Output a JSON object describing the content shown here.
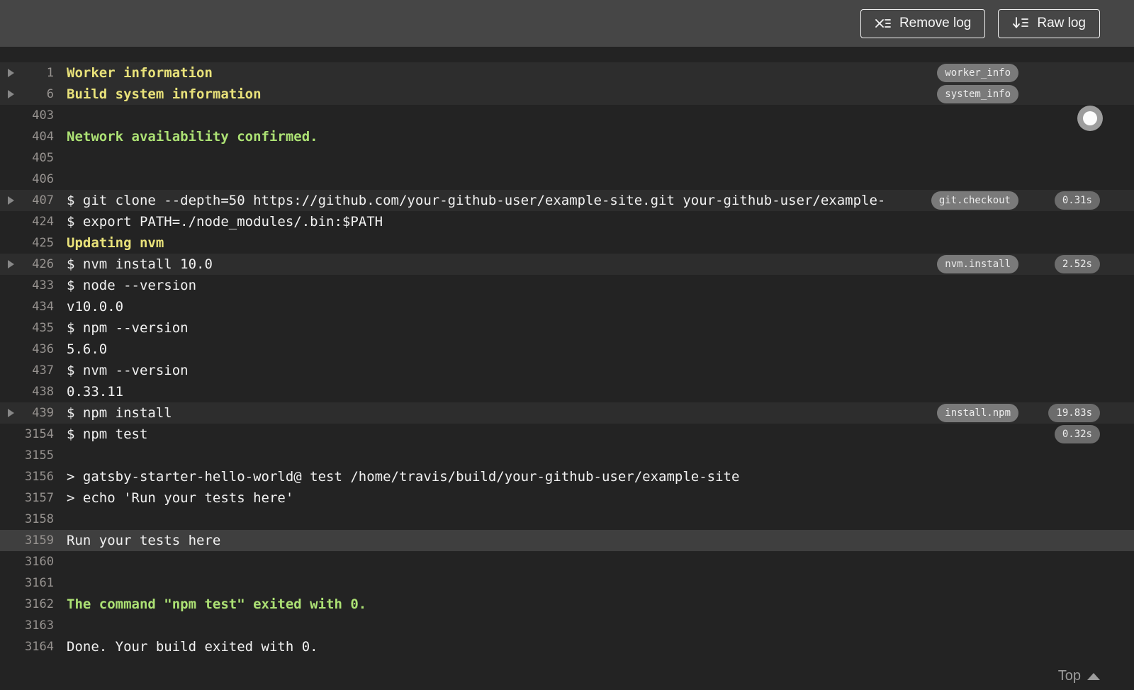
{
  "colors": {
    "header_bg": "#464646",
    "log_bg": "#232323",
    "fold_row_bg": "#2d2d2d",
    "highlight_row_bg": "#3f3f3f",
    "text": "#f1f1f1",
    "yellow": "#e9e27a",
    "green": "#ace174",
    "line_number": "#979390",
    "badge_bg": "#7a7a7a"
  },
  "header": {
    "remove_log_label": "Remove log",
    "remove_log_icon": "x-list-icon",
    "raw_log_label": "Raw log",
    "raw_log_icon": "download-list-icon"
  },
  "log": {
    "top_link_label": "Top",
    "follow_toggle_icon": "radio-circle-icon",
    "rows": [
      {
        "num": "1",
        "text": "Worker information",
        "style": "yellow",
        "fold": true,
        "fold_bg": true,
        "name_badge": "worker_info"
      },
      {
        "num": "6",
        "text": "Build system information",
        "style": "yellow",
        "fold": true,
        "fold_bg": true,
        "name_badge": "system_info"
      },
      {
        "num": "403",
        "text": ""
      },
      {
        "num": "404",
        "text": "Network availability confirmed.",
        "style": "green"
      },
      {
        "num": "405",
        "text": ""
      },
      {
        "num": "406",
        "text": ""
      },
      {
        "num": "407",
        "text": "$ git clone --depth=50 https://github.com/your-github-user/example-site.git your-github-user/example-",
        "fold": true,
        "fold_bg": true,
        "name_badge": "git.checkout",
        "time_badge": "0.31s"
      },
      {
        "num": "424",
        "text": "$ export PATH=./node_modules/.bin:$PATH"
      },
      {
        "num": "425",
        "text": "Updating nvm",
        "style": "yellow"
      },
      {
        "num": "426",
        "text": "$ nvm install 10.0",
        "fold": true,
        "fold_bg": true,
        "name_badge": "nvm.install",
        "time_badge": "2.52s"
      },
      {
        "num": "433",
        "text": "$ node --version"
      },
      {
        "num": "434",
        "text": "v10.0.0"
      },
      {
        "num": "435",
        "text": "$ npm --version"
      },
      {
        "num": "436",
        "text": "5.6.0"
      },
      {
        "num": "437",
        "text": "$ nvm --version"
      },
      {
        "num": "438",
        "text": "0.33.11"
      },
      {
        "num": "439",
        "text": "$ npm install",
        "fold": true,
        "fold_bg": true,
        "name_badge": "install.npm",
        "time_badge": "19.83s"
      },
      {
        "num": "3154",
        "text": "$ npm test",
        "time_badge": "0.32s"
      },
      {
        "num": "3155",
        "text": ""
      },
      {
        "num": "3156",
        "text": "> gatsby-starter-hello-world@ test /home/travis/build/your-github-user/example-site"
      },
      {
        "num": "3157",
        "text": "> echo 'Run your tests here'"
      },
      {
        "num": "3158",
        "text": ""
      },
      {
        "num": "3159",
        "text": "Run your tests here",
        "highlight": true
      },
      {
        "num": "3160",
        "text": ""
      },
      {
        "num": "3161",
        "text": ""
      },
      {
        "num": "3162",
        "text": "The command \"npm test\" exited with 0.",
        "style": "green"
      },
      {
        "num": "3163",
        "text": ""
      },
      {
        "num": "3164",
        "text": "Done. Your build exited with 0."
      }
    ]
  }
}
